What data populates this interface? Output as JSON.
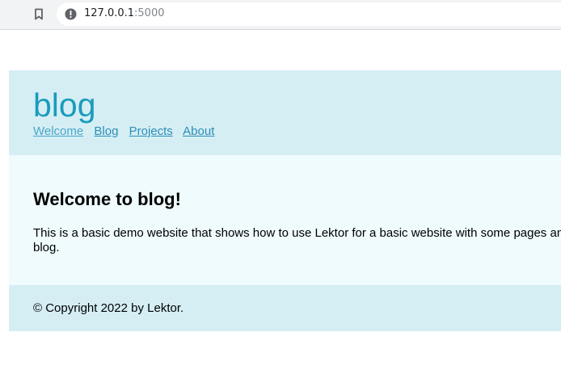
{
  "browser": {
    "url_host": "127.0.0.1",
    "url_port": ":5000"
  },
  "header": {
    "title": "blog",
    "nav": [
      {
        "label": "Welcome"
      },
      {
        "label": "Blog"
      },
      {
        "label": "Projects"
      },
      {
        "label": "About"
      }
    ]
  },
  "main": {
    "heading": "Welcome to blog!",
    "body": "This is a basic demo website that shows how to use Lektor for a basic website with some pages and a blog."
  },
  "footer": {
    "text": "© Copyright 2022 by Lektor."
  },
  "colors": {
    "header_bg": "#d5eef4",
    "main_bg": "#effbfd",
    "title": "#1a9bbd",
    "link": "#2b8fb8"
  },
  "icons": {
    "bookmark": "bookmark-icon",
    "site_info": "info-icon"
  }
}
